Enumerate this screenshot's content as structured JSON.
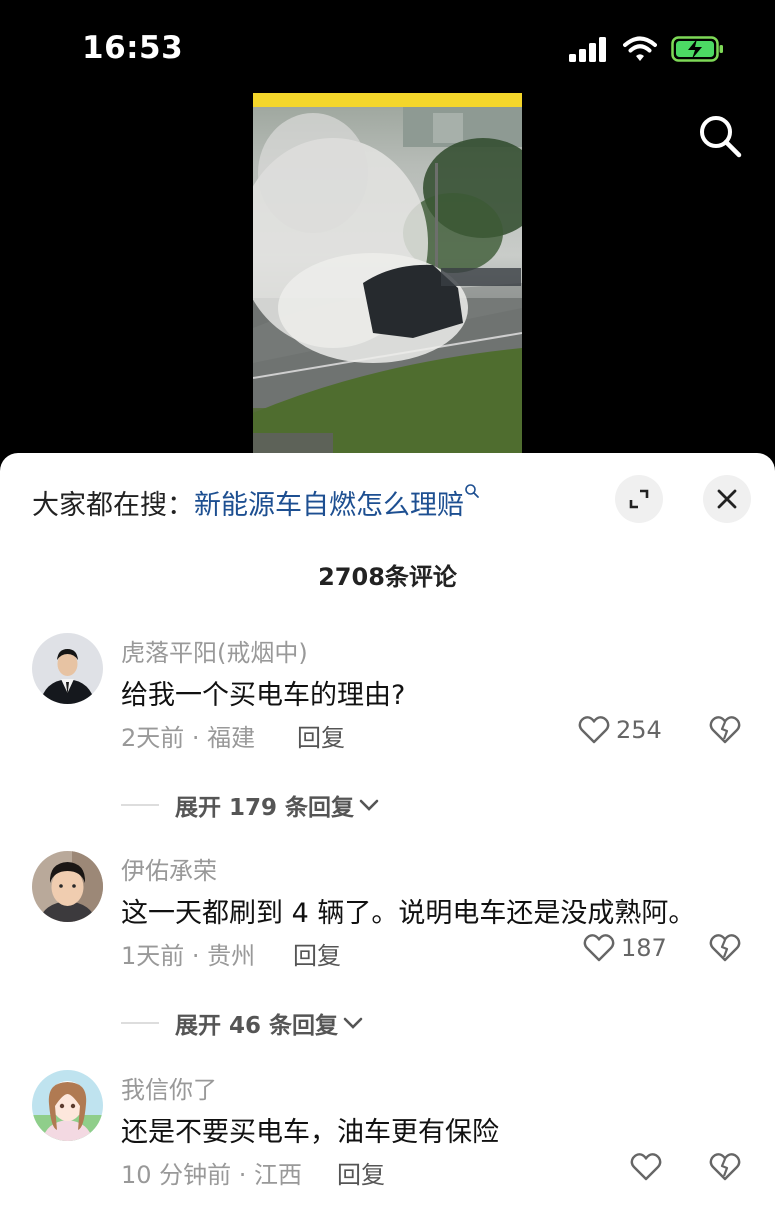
{
  "status": {
    "time": "16:53"
  },
  "header": {
    "search_icon": "search-icon"
  },
  "sheet": {
    "search_prefix": "大家都在搜：",
    "search_keyword": "新能源车自燃怎么理赔",
    "comment_count": "2708条评论",
    "icons": [
      "expand-icon",
      "close-icon"
    ]
  },
  "comments": [
    {
      "name": "虎落平阳(戒烟中)",
      "text": "给我一个买电车的理由?",
      "meta": "2天前 · 福建",
      "reply_label": "回复",
      "likes": "254",
      "expand_label": "展开 179 条回复"
    },
    {
      "name": "伊佑承荣",
      "text": "这一天都刷到 4 辆了。说明电车还是没成熟阿。",
      "meta": "1天前 · 贵州",
      "reply_label": "回复",
      "likes": "187",
      "expand_label": "展开 46 条回复"
    },
    {
      "name": "我信你了",
      "text": "还是不要买电车，油车更有保险",
      "meta": "10 分钟前 · 江西",
      "reply_label": "回复",
      "likes": ""
    }
  ]
}
